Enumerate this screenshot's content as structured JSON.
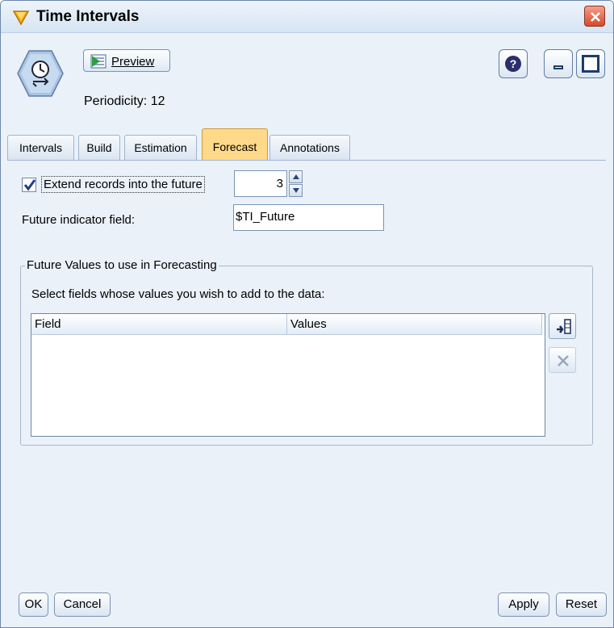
{
  "window": {
    "title": "Time Intervals"
  },
  "toolbar": {
    "preview_label": "Preview",
    "periodicity_text": "Periodicity: 12"
  },
  "tabs": [
    {
      "label": "Intervals"
    },
    {
      "label": "Build"
    },
    {
      "label": "Estimation"
    },
    {
      "label": "Forecast",
      "active": true
    },
    {
      "label": "Annotations"
    }
  ],
  "forecast": {
    "extend_checkbox_label": "Extend records into the future",
    "extend_checked": true,
    "extend_value": "3",
    "future_indicator_label": "Future indicator field:",
    "future_indicator_value": "$TI_Future",
    "group_title": "Future Values to use in Forecasting",
    "select_label": "Select fields whose values you wish to add to the data:",
    "table_columns": [
      "Field",
      "Values"
    ],
    "table_rows": []
  },
  "footer": {
    "ok_label": "OK",
    "cancel_label": "Cancel",
    "apply_label": "Apply",
    "reset_label": "Reset"
  },
  "icons": {
    "title": "diamond-node-icon",
    "node": "clock-node-icon",
    "preview": "preview-icon",
    "help": "help-icon",
    "minimize": "minimize-icon",
    "maximize": "maximize-icon",
    "close": "close-icon",
    "add_field": "field-picker-icon",
    "delete": "delete-icon"
  },
  "colors": {
    "active_tab": "#ffd98a",
    "window_bg": "#eaf1f9",
    "close_button": "#d44a2b"
  }
}
